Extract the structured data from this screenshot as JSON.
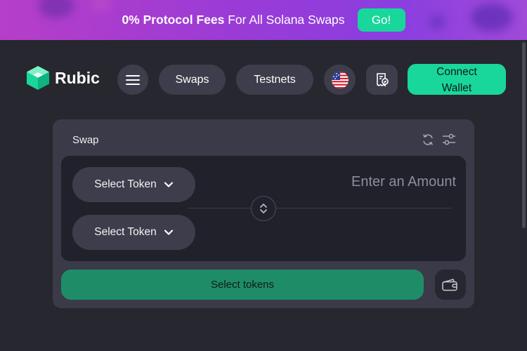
{
  "banner": {
    "highlight": "0% Protocol Fees",
    "text": " For All Solana Swaps",
    "go_label": "Go!"
  },
  "header": {
    "logo_text": "Rubic",
    "swaps_label": "Swaps",
    "testnets_label": "Testnets",
    "connect_line1": "Connect",
    "connect_line2": "Wallet"
  },
  "swap": {
    "title": "Swap",
    "from_token_label": "Select Token",
    "to_token_label": "Select Token",
    "amount_placeholder": "Enter an Amount",
    "submit_label": "Select tokens"
  },
  "colors": {
    "accent": "#19d79b",
    "background": "#27272f",
    "card": "#3a3a48",
    "banner": "#9a3bd6"
  },
  "icons": {
    "logo": "cube-logo-icon",
    "menu": "hamburger-menu-icon",
    "language": "us-flag-icon",
    "history": "receipt-history-icon",
    "refresh": "refresh-icon",
    "settings": "sliders-settings-icon",
    "dropdown": "chevron-down-icon",
    "switch": "swap-arrows-icon",
    "wallet": "wallet-icon"
  }
}
